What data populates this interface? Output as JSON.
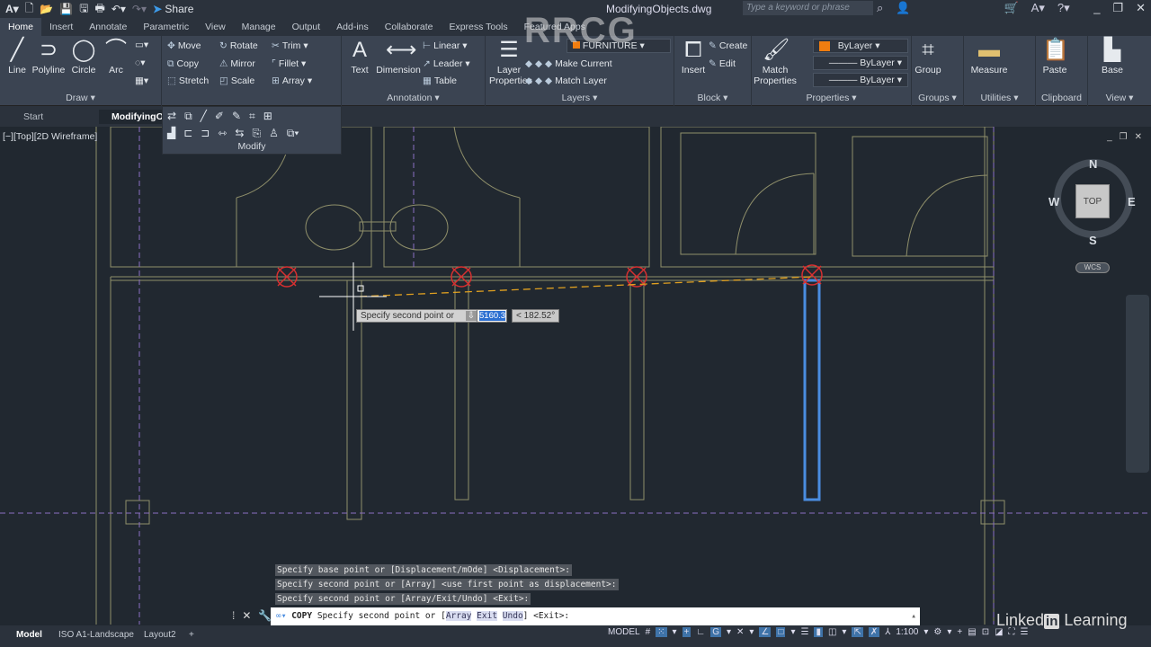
{
  "app": {
    "title": "ModifyingObjects.dwg",
    "search_placeholder": "Type a keyword or phrase",
    "share_label": "Share",
    "watermark": "RRCG"
  },
  "ribbon_tabs": [
    "Home",
    "Insert",
    "Annotate",
    "Parametric",
    "View",
    "Manage",
    "Output",
    "Add-ins",
    "Collaborate",
    "Express Tools",
    "Featured Apps"
  ],
  "active_tab": "Home",
  "panels": {
    "draw": {
      "title": "Draw",
      "tools": [
        "Line",
        "Polyline",
        "Circle",
        "Arc"
      ]
    },
    "modify": {
      "title": "Modify",
      "tools": [
        "Move",
        "Rotate",
        "Trim",
        "Copy",
        "Mirror",
        "Fillet",
        "Stretch",
        "Scale",
        "Array"
      ]
    },
    "annotation": {
      "title": "Annotation",
      "tools": [
        "Text",
        "Dimension",
        "Linear",
        "Leader",
        "Table"
      ]
    },
    "layers": {
      "title": "Layers",
      "layer_properties": "Layer Properties",
      "current_layer": "FURNITURE",
      "make_current": "Make Current",
      "match_layer": "Match Layer"
    },
    "block": {
      "title": "Block",
      "insert": "Insert",
      "create": "Create",
      "edit": "Edit"
    },
    "properties": {
      "title": "Properties",
      "match": "Match Properties",
      "color": "ByLayer",
      "linetype": "ByLayer",
      "lineweight": "ByLayer",
      "color_swatch": "#f07d10"
    },
    "groups": {
      "title": "Groups",
      "group": "Group"
    },
    "utilities": {
      "title": "Utilities",
      "measure": "Measure"
    },
    "clipboard": {
      "title": "Clipboard",
      "paste": "Paste"
    },
    "view": {
      "title": "View",
      "base": "Base"
    }
  },
  "file_tabs": [
    "Start",
    "ModifyingOb"
  ],
  "viewport": {
    "label": "[−][Top][2D Wireframe]",
    "compass": {
      "n": "N",
      "s": "S",
      "e": "E",
      "w": "W",
      "top": "TOP",
      "wcs": "WCS"
    }
  },
  "dynamic_input": {
    "prompt": "Specify second point or",
    "distance": "5160.3",
    "angle": "< 182.52°"
  },
  "command_history": [
    "Specify base point or [Displacement/mOde] <Displacement>:",
    "Specify second point or [Array] <use first point as displacement>:",
    "Specify second point or [Array/Exit/Undo] <Exit>:"
  ],
  "command_line": {
    "command": "COPY",
    "text": "Specify second point or [",
    "options": [
      "Array",
      "Exit",
      "Undo"
    ],
    "tail": "] <Exit>:"
  },
  "layout_tabs": [
    "Model",
    "ISO A1-Landscape",
    "Layout2",
    "+"
  ],
  "status": {
    "model": "MODEL",
    "scale": "1:100"
  },
  "branding": {
    "linkedin": "Linked",
    "in": "in",
    "learning": "Learning"
  }
}
